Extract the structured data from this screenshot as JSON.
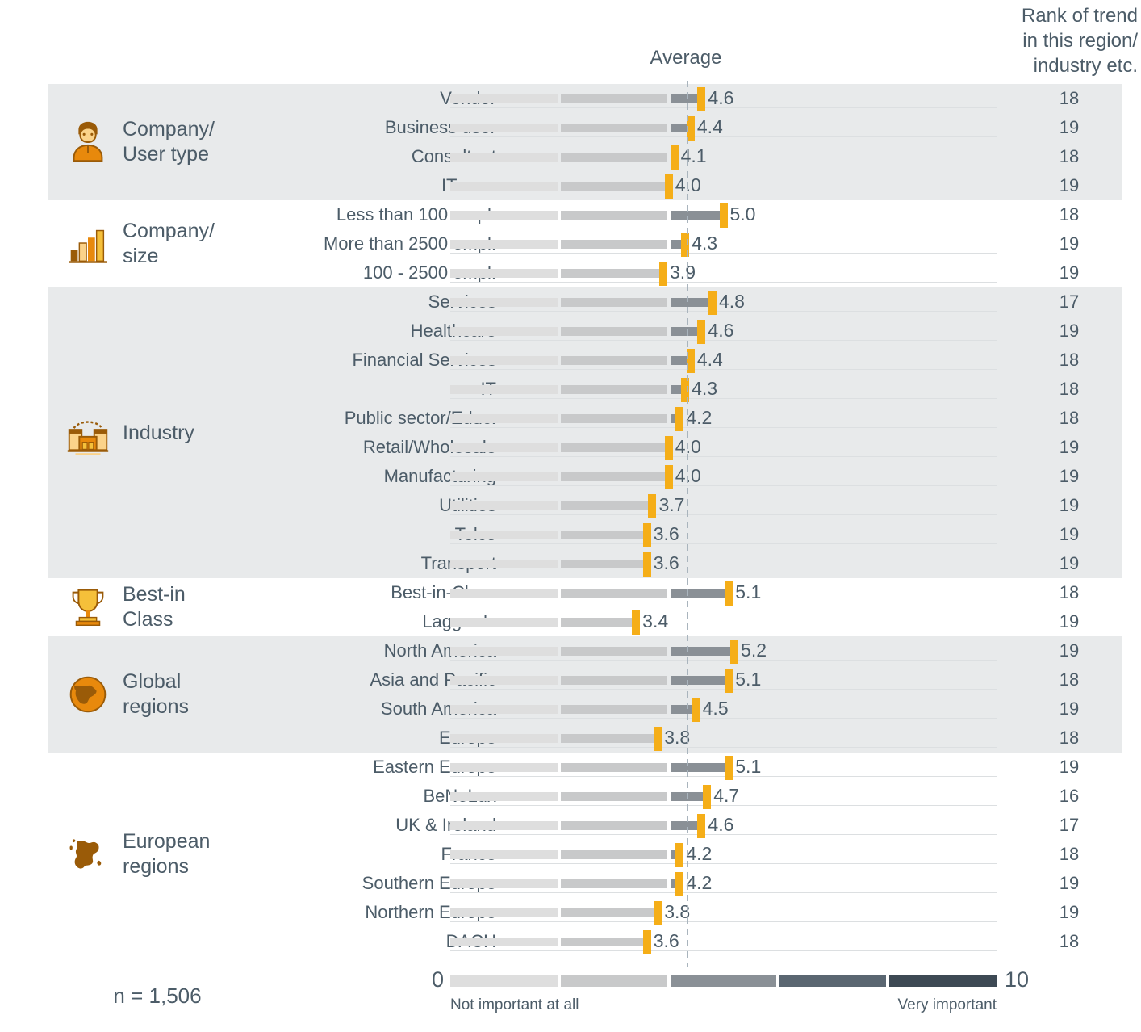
{
  "header": {
    "rank_title": "Rank of trend\nin this region/\nindustry etc.",
    "average_label": "Average"
  },
  "axis": {
    "min_label": "0",
    "max_label": "10",
    "low_text": "Not important at all",
    "high_text": "Very important",
    "min": 0,
    "max": 10
  },
  "footnote": {
    "n_label": "n = 1,506"
  },
  "colors": {
    "marker": "#f5ae18",
    "text": "#4c5c68",
    "band_shaded": "#e8eaeb",
    "band_plain": "#ffffff",
    "avg_line": "#a9b4bd",
    "segments": [
      "#dedede",
      "#c8c9ca",
      "#8a9096",
      "#5a6671",
      "#3d4954"
    ]
  },
  "chart_data": {
    "type": "bar",
    "title": "Average",
    "xlabel": "",
    "ylabel": "",
    "xlim": [
      0,
      10
    ],
    "grid": false,
    "legend": "none",
    "average_marker_value": 4.33,
    "notes": "Horizontal segmented bar chart; orange marker denotes the average score per segment. Right column gives rank of trend.",
    "groups": [
      {
        "name": "Company/\nUser type",
        "icon": "user-avatar-icon",
        "shaded": true,
        "rows": [
          {
            "label": "Vendor",
            "value": 4.6,
            "value_label": "4.6",
            "rank": "18"
          },
          {
            "label": "Business user",
            "value": 4.4,
            "value_label": "4.4",
            "rank": "19"
          },
          {
            "label": "Consultant",
            "value": 4.1,
            "value_label": "4.1",
            "rank": "18"
          },
          {
            "label": "IT user",
            "value": 4.0,
            "value_label": "4.0",
            "rank": "19"
          }
        ]
      },
      {
        "name": "Company/\nsize",
        "icon": "bar-chart-icon",
        "shaded": false,
        "rows": [
          {
            "label": "Less than 100 empl.",
            "value": 5.0,
            "value_label": "5.0",
            "rank": "18"
          },
          {
            "label": "More than 2500 empl.",
            "value": 4.3,
            "value_label": "4.3",
            "rank": "19"
          },
          {
            "label": "100 - 2500 empl.",
            "value": 3.9,
            "value_label": "3.9",
            "rank": "19"
          }
        ]
      },
      {
        "name": "Industry",
        "icon": "factory-building-icon",
        "shaded": true,
        "rows": [
          {
            "label": "Services",
            "value": 4.8,
            "value_label": "4.8",
            "rank": "17"
          },
          {
            "label": "Healthcare",
            "value": 4.6,
            "value_label": "4.6",
            "rank": "19"
          },
          {
            "label": "Financial Services",
            "value": 4.4,
            "value_label": "4.4",
            "rank": "18"
          },
          {
            "label": "IT",
            "value": 4.3,
            "value_label": "4.3",
            "rank": "18"
          },
          {
            "label": "Public sector/Educ.",
            "value": 4.2,
            "value_label": "4.2",
            "rank": "18"
          },
          {
            "label": "Retail/Wholesale",
            "value": 4.0,
            "value_label": "4.0",
            "rank": "19"
          },
          {
            "label": "Manufacturing",
            "value": 4.0,
            "value_label": "4.0",
            "rank": "19"
          },
          {
            "label": "Utilities",
            "value": 3.7,
            "value_label": "3.7",
            "rank": "19"
          },
          {
            "label": "Telco",
            "value": 3.6,
            "value_label": "3.6",
            "rank": "19"
          },
          {
            "label": "Transport",
            "value": 3.6,
            "value_label": "3.6",
            "rank": "19"
          }
        ]
      },
      {
        "name": "Best-in\nClass",
        "icon": "trophy-icon",
        "shaded": false,
        "rows": [
          {
            "label": "Best-in-Class",
            "value": 5.1,
            "value_label": "5.1",
            "rank": "18"
          },
          {
            "label": "Laggards",
            "value": 3.4,
            "value_label": "3.4",
            "rank": "19"
          }
        ]
      },
      {
        "name": "Global\nregions",
        "icon": "globe-icon",
        "shaded": true,
        "rows": [
          {
            "label": "North America",
            "value": 5.2,
            "value_label": "5.2",
            "rank": "19"
          },
          {
            "label": "Asia and Pacific",
            "value": 5.1,
            "value_label": "5.1",
            "rank": "18"
          },
          {
            "label": "South America",
            "value": 4.5,
            "value_label": "4.5",
            "rank": "19"
          },
          {
            "label": "Europe",
            "value": 3.8,
            "value_label": "3.8",
            "rank": "18"
          }
        ]
      },
      {
        "name": "European\nregions",
        "icon": "europe-map-icon",
        "shaded": false,
        "rows": [
          {
            "label": "Eastern Europe",
            "value": 5.1,
            "value_label": "5.1",
            "rank": "19"
          },
          {
            "label": "BeNeLux",
            "value": 4.7,
            "value_label": "4.7",
            "rank": "16"
          },
          {
            "label": "UK & Ireland",
            "value": 4.6,
            "value_label": "4.6",
            "rank": "17"
          },
          {
            "label": "France",
            "value": 4.2,
            "value_label": "4.2",
            "rank": "18"
          },
          {
            "label": "Southern Europe",
            "value": 4.2,
            "value_label": "4.2",
            "rank": "19"
          },
          {
            "label": "Northern Europe",
            "value": 3.8,
            "value_label": "3.8",
            "rank": "19"
          },
          {
            "label": "DACH",
            "value": 3.6,
            "value_label": "3.6",
            "rank": "18"
          }
        ]
      }
    ]
  }
}
